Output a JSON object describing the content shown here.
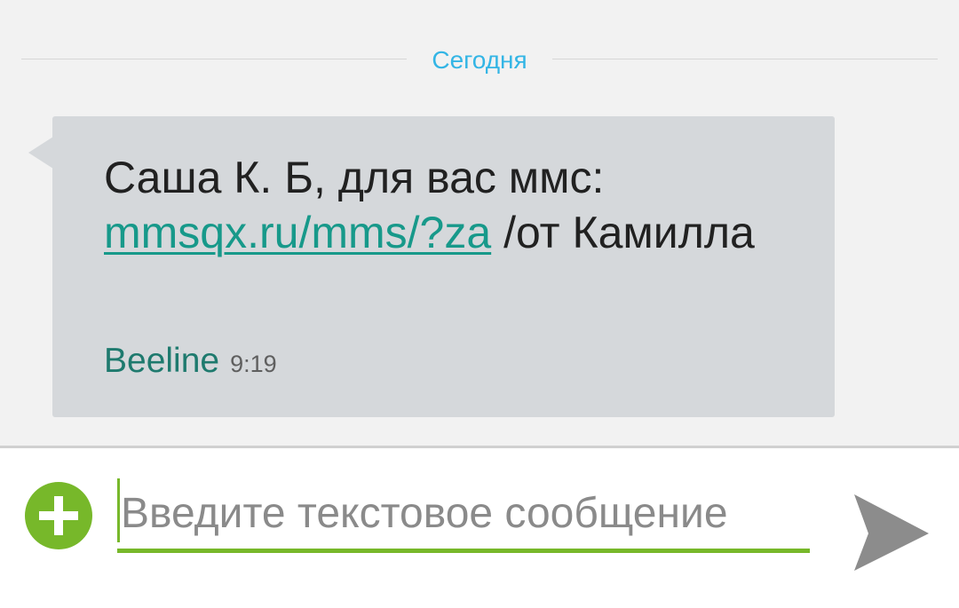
{
  "thread": {
    "date_label": "Сегодня"
  },
  "message": {
    "text_before_link": "Саша К. Б, для вас ммс: ",
    "link_text": "mmsqx.ru/mms/?za",
    "text_after_link": " /от Камилла",
    "sender": "Beeline",
    "time": "9:19"
  },
  "composer": {
    "placeholder": "Введите текстовое сообщение",
    "value": ""
  },
  "icons": {
    "attach": "plus-circle-icon",
    "send": "send-arrow-icon"
  },
  "colors": {
    "accent_green": "#77b82a",
    "date_blue": "#33b5e5",
    "link_teal": "#17998a",
    "sender_teal": "#1e7a6e",
    "bubble_gray": "#d5d8db",
    "send_gray": "#8c8c8c"
  }
}
